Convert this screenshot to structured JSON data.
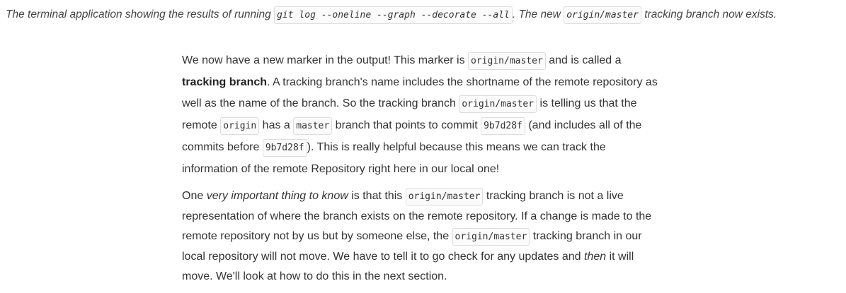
{
  "caption": {
    "prefix": "The terminal application showing the results of running ",
    "command": "git log --oneline --graph --decorate --all",
    "middle": ". The new ",
    "branch": "origin/master",
    "suffix": " tracking branch now exists."
  },
  "paragraph1": {
    "t1": "We now have a new marker in the output! This marker is ",
    "c1": "origin/master",
    "t2": " and is called a ",
    "strong1": "tracking branch",
    "t3": ". A tracking branch's name includes the shortname of the remote repository as well as the name of the branch. So the tracking branch ",
    "c2": "origin/master",
    "t4": " is telling us that the remote ",
    "c3": "origin",
    "t5": " has a ",
    "c4": "master",
    "t6": " branch that points to commit ",
    "c5": "9b7d28f",
    "t7": " (and includes all of the commits before ",
    "c6": "9b7d28f",
    "t8": "). This is really helpful because this means we can track the information of the remote Repository right here in our local one!"
  },
  "paragraph2": {
    "t1": "One ",
    "em1": "very important thing to know",
    "t2": " is that this ",
    "c1": "origin/master",
    "t3": " tracking branch is not a live representation of where the branch exists on the remote repository. If a change is made to the remote repository not by us but by someone else, the ",
    "c2": "origin/master",
    "t4": " tracking branch in our local repository will not move. We have to tell it to go check for any updates and ",
    "em2": "then",
    "t5": " it will move. We'll look at how to do this in the next section."
  }
}
